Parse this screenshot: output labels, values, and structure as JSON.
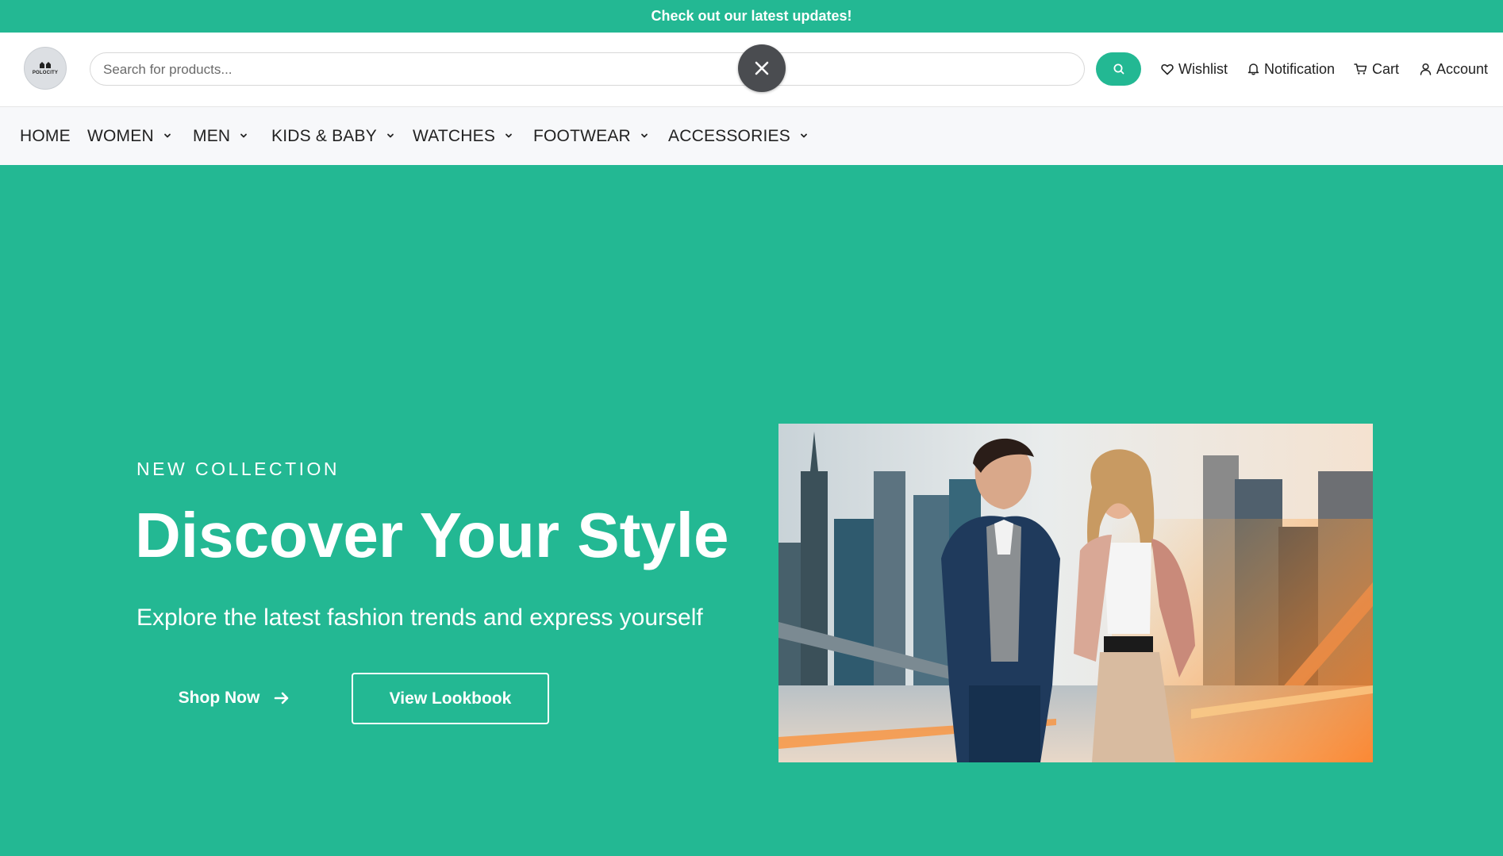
{
  "announcement": {
    "text": "Check out our latest updates!"
  },
  "header": {
    "logo_text": "POLOCITY",
    "search": {
      "placeholder": "Search for products...",
      "value": ""
    },
    "clear_icon": "close-icon",
    "search_icon": "search-icon",
    "links": [
      {
        "label": "Wishlist",
        "icon": "heart-icon"
      },
      {
        "label": "Notification",
        "icon": "bell-icon"
      },
      {
        "label": "Cart",
        "icon": "cart-icon"
      },
      {
        "label": "Account",
        "icon": "user-icon"
      }
    ]
  },
  "nav": {
    "items": [
      {
        "label": "HOME",
        "has_dropdown": false
      },
      {
        "label": "WOMEN",
        "has_dropdown": true
      },
      {
        "label": "MEN",
        "has_dropdown": true
      },
      {
        "label": "KIDS & BABY",
        "has_dropdown": true
      },
      {
        "label": "WATCHES",
        "has_dropdown": true
      },
      {
        "label": "FOOTWEAR",
        "has_dropdown": true
      },
      {
        "label": "ACCESSORIES",
        "has_dropdown": true
      }
    ]
  },
  "hero": {
    "eyebrow": "NEW COLLECTION",
    "title": "Discover Your Style",
    "subtitle": "Explore the latest fashion trends and express yourself",
    "primary_button": "Shop Now",
    "secondary_button": "View Lookbook"
  },
  "colors": {
    "accent": "#23b893",
    "clear_button": "#4a4c50",
    "nav_bg": "#f7f8fa"
  }
}
